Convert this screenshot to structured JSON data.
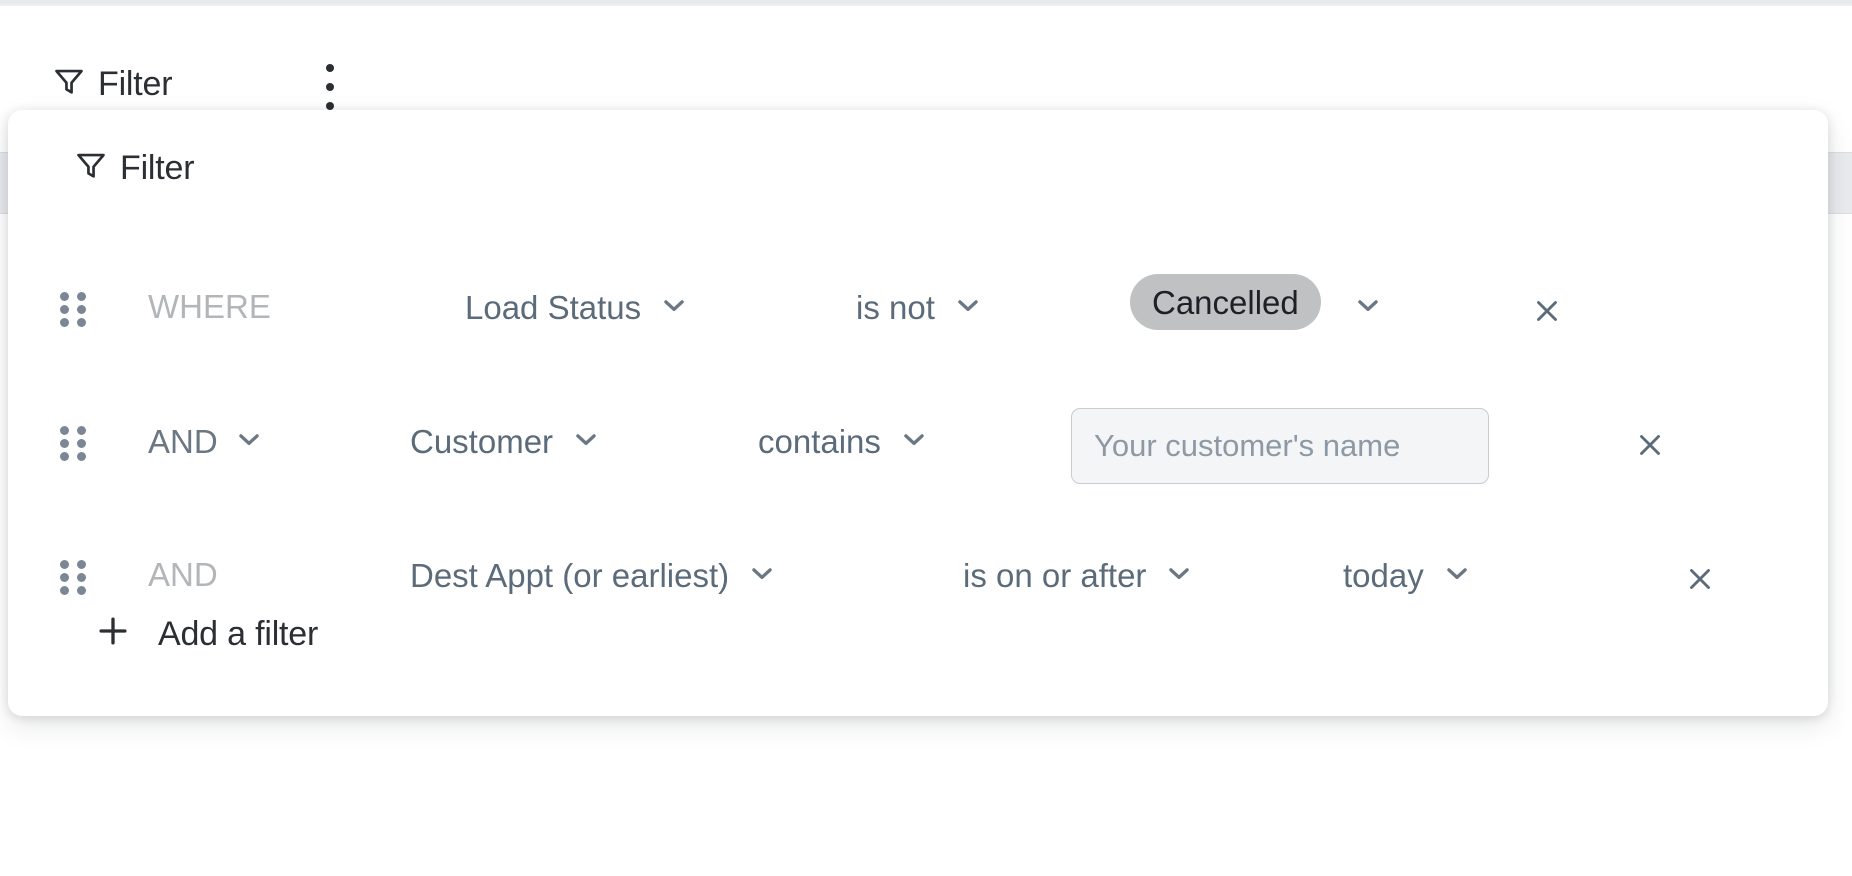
{
  "toolbar": {
    "filter_label": "Filter",
    "filter_icon": "funnel-icon",
    "overflow_menu_icon": "kebab-menu-icon"
  },
  "panel": {
    "title": "Filter",
    "title_icon": "funnel-icon",
    "add_filter_label": "Add a filter",
    "add_filter_icon": "plus-icon",
    "remove_icon": "close-icon",
    "drag_icon": "drag-handle-icon",
    "chevron_icon": "chevron-down-icon",
    "rows": [
      {
        "conjunction": "WHERE",
        "conjunction_editable": false,
        "field": "Load Status",
        "operator": "is not",
        "value_kind": "chip",
        "value": "Cancelled",
        "value_placeholder": ""
      },
      {
        "conjunction": "AND",
        "conjunction_editable": true,
        "field": "Customer",
        "operator": "contains",
        "value_kind": "input",
        "value": "",
        "value_placeholder": "Your customer's name"
      },
      {
        "conjunction": "AND",
        "conjunction_editable": false,
        "field": "Dest Appt (or earliest)",
        "operator": "is on or after",
        "value_kind": "select",
        "value": "today",
        "value_placeholder": ""
      }
    ]
  },
  "colors": {
    "text_primary": "#2b2f33",
    "text_secondary": "#5b6b7a",
    "text_muted": "#b3b6b9",
    "chip_background": "#bfc1c3",
    "panel_background": "#ffffff",
    "input_background": "#f4f5f6",
    "input_border": "#c9cdd2",
    "drag_dot": "#7b8794"
  }
}
